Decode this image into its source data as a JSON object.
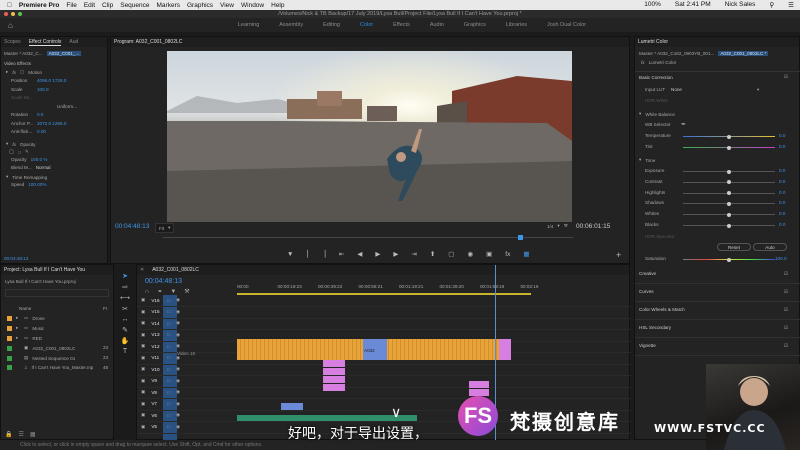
{
  "menubar": {
    "app": "Premiere Pro",
    "items": [
      "File",
      "Edit",
      "Clip",
      "Sequence",
      "Markers",
      "Graphics",
      "View",
      "Window",
      "Help"
    ],
    "battery": "100%",
    "clock": "Sat 2:41 PM",
    "user": "Nick Sales"
  },
  "window_title": "/Volumes/Nick & TB Backup/17 July 2019/Lysa Bull/Project File/Lysa Bull If I Can't Have You.prproj *",
  "workspaces": [
    "Learning",
    "Assembly",
    "Editing",
    "Color",
    "Effects",
    "Audio",
    "Graphics",
    "Libraries",
    "Josh Dual Color"
  ],
  "active_workspace": "Color",
  "effect_controls": {
    "tabs": [
      "Scopes",
      "Effect Controls",
      "Aud"
    ],
    "master": "Master * A032_C...",
    "clip": "A032_C001_...",
    "section": "Video Effects",
    "motion": "Motion",
    "rows": [
      {
        "label": "Position",
        "value": "4096.0   1728.0"
      },
      {
        "label": "Scale",
        "value": "100.0"
      },
      {
        "label": "Scale Wi..",
        "value": ""
      },
      {
        "label": "",
        "value": "Uniform..."
      },
      {
        "label": "Rotation",
        "value": "0.0"
      },
      {
        "label": "Anchor P...",
        "value": "2072.0   1296.0"
      },
      {
        "label": "Anti-flick...",
        "value": "0.00"
      }
    ],
    "opacity": "Opacity",
    "opacity_value": "100.0 %",
    "blend_label": "Blend M...",
    "blend_value": "Normal",
    "time_remap": "Time Remapping",
    "speed_label": "Speed",
    "speed_value": "100.00%",
    "timecode": "00:04:48:13"
  },
  "program": {
    "title": "Program: A032_C001_0802LC",
    "timecode": "00:04:48:13",
    "fit": "Fit",
    "quality": "1/4",
    "duration": "00:06:01:15"
  },
  "project": {
    "tab": "Project: Lysa Bull If I Can't Have You",
    "file": "Lysa Bull If I Can't Have You.prproj",
    "header_name": "Name",
    "header_fps": "Fr",
    "items": [
      {
        "name": "Drone",
        "color": "#e8a23a",
        "type": "folder",
        "fps": ""
      },
      {
        "name": "Music",
        "color": "#e8a23a",
        "type": "folder",
        "fps": ""
      },
      {
        "name": "RED",
        "color": "#e8a23a",
        "type": "folder",
        "fps": ""
      },
      {
        "name": "A032_C001_0802LC",
        "color": "#3aa04a",
        "type": "clip",
        "fps": "23"
      },
      {
        "name": "Nested Sequence 01",
        "color": "#3aa04a",
        "type": "seq",
        "fps": "23"
      },
      {
        "name": "If I Can't Have You_Master.mp",
        "color": "#3aa04a",
        "type": "audio",
        "fps": "48"
      }
    ]
  },
  "timeline": {
    "tab": "A032_C001_0802LC",
    "timecode": "00:04:48:13",
    "ruler": [
      "00:00",
      "00:00:19:23",
      "00:00:39:22",
      "00:00:59:21",
      "00:01:19:21",
      "00:01:39:20",
      "00:01:59:19",
      "00:02:19"
    ],
    "tracks": [
      "V16",
      "V15",
      "V14",
      "V13",
      "V12",
      "V11",
      "V10",
      "V9",
      "V8",
      "V7",
      "V6",
      "V5"
    ],
    "video_label": "Video 16",
    "clip_label": "A032"
  },
  "lumetri": {
    "tab": "Lumetri Color",
    "master": "Master * A032_C162_0903YB_001...",
    "clip": "A032_C001_0802LC *",
    "effect": "Lumetri Color",
    "basic": "Basic Correction",
    "input_lut_label": "Input LUT",
    "input_lut_value": "None",
    "hdr_white": "HDR White",
    "white_balance": "White Balance",
    "wb_selector": "WB Selector",
    "temperature": "Temperature",
    "temperature_value": "0.0",
    "temperature_level": 0.5,
    "tint": "Tint",
    "tint_value": "0.0",
    "tint_level": 0.5,
    "tone": "Tone",
    "tone_rows": [
      {
        "label": "Exposure",
        "value": "0.0",
        "level": 0.5
      },
      {
        "label": "Contrast",
        "value": "0.0",
        "level": 0.5
      },
      {
        "label": "Highlights",
        "value": "0.0",
        "level": 0.5
      },
      {
        "label": "Shadows",
        "value": "0.0",
        "level": 0.5
      },
      {
        "label": "Whites",
        "value": "0.0",
        "level": 0.5
      },
      {
        "label": "Blacks",
        "value": "0.0",
        "level": 0.5
      }
    ],
    "hdr_specular": "HDR Specular",
    "reset": "Reset",
    "auto": "Auto",
    "saturation": "Saturation",
    "saturation_value": "100.0",
    "saturation_level": 0.5,
    "sections": [
      "Creative",
      "Curves",
      "Color Wheels & Match",
      "HSL Secondary",
      "Vignette"
    ]
  },
  "status_text": "Click to select, or click in empty space and drag to marquee select. Use Shift, Opt, and Cmd for other options.",
  "subtitle": "好吧，对于导出设置，",
  "watermark": {
    "logo": "FS",
    "text": "梵摄创意库",
    "url": "WWW.FSTVC.CC"
  },
  "colors": {
    "accent_blue": "#3f95e8",
    "clip_orange": "#e8a33a",
    "clip_pink": "#d77fe0",
    "clip_blue": "#6a8ad8"
  }
}
